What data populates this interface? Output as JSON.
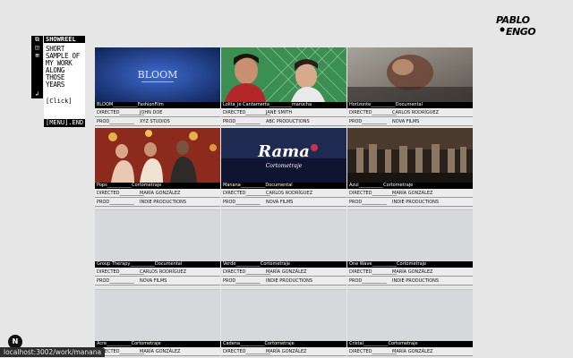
{
  "logo": {
    "text": "PABLO ENGO"
  },
  "sidebar": {
    "title": "SHOWREEL",
    "blurb": "SHORT SAMPLE OF MY WORK ALONG THOSE YEARS",
    "click": "[Click]",
    "menu": "[MENU].END",
    "icons": [
      "prev-icon",
      "stack-icon",
      "split-icon",
      "return-icon"
    ]
  },
  "projects": [
    {
      "title": "BLOOM___________FashionFilm",
      "director": "JOHN DOE",
      "prod": "XYZ STUDIOS",
      "thumb": "bloom"
    },
    {
      "title": "Lolita_je Cantamerta__________marucha",
      "director": "JANE SMITH",
      "prod": "ABC PRODUCTIONS",
      "thumb": "lolita"
    },
    {
      "title": "Horizonte___________Documental",
      "director": "CARLOS RODRÍGUEZ",
      "prod": "NOVA FILMS",
      "thumb": "horizonte"
    },
    {
      "title": "Pops___________Cortometraje",
      "director": "MARÍA GONZÁLEZ",
      "prod": "INDIE PRODUCTIONS",
      "thumb": "pops"
    },
    {
      "title": "Manana___________Documental",
      "director": "CARLOS RODRÍGUEZ",
      "prod": "NOVA FILMS",
      "thumb": "manana"
    },
    {
      "title": "Azul___________Cortometraje",
      "director": "MARÍA GONZÁLEZ",
      "prod": "INDIE PRODUCTIONS",
      "thumb": "azul"
    },
    {
      "title": "Group Therapy___________Documental",
      "director": "CARLOS RODRÍGUEZ",
      "prod": "NOVA FILMS",
      "thumb": ""
    },
    {
      "title": "Verde___________Cortometraje",
      "director": "MARÍA GONZÁLEZ",
      "prod": "INDIE PRODUCTIONS",
      "thumb": ""
    },
    {
      "title": "One Wave___________Cortometraje",
      "director": "MARÍA GONZÁLEZ",
      "prod": "INDIE PRODUCTIONS",
      "thumb": ""
    },
    {
      "title": "Acre___________Cortometraje",
      "director": "MARÍA GONZÁLEZ",
      "prod": "",
      "thumb": ""
    },
    {
      "title": "Cadena___________Cortometraje",
      "director": "MARÍA GONZÁLEZ",
      "prod": "",
      "thumb": ""
    },
    {
      "title": "Cristal___________Cortometraje",
      "director": "MARÍA GONZÁLEZ",
      "prod": "",
      "thumb": ""
    }
  ],
  "labels": {
    "directed": "DIRECTED___________",
    "prod": "PROD___________"
  },
  "bloom_thumb_text": "BLOOM",
  "rama_thumb_text": "Rama",
  "rama_thumb_sub": "Cortometraje",
  "status_url": "localhost:3002/work/manana",
  "fab_label": "N"
}
